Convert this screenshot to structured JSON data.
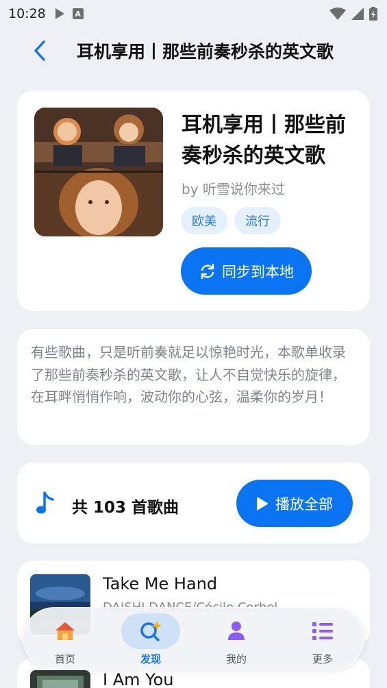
{
  "status_bar": {
    "time": "10:28"
  },
  "header": {
    "title": "耳机享用丨那些前奏秒杀的英文歌"
  },
  "playlist": {
    "name": "耳机享用丨那些前奏秒杀的英文歌",
    "author": "by 听雪说你来过",
    "tags": [
      "欧美",
      "流行"
    ],
    "sync_label": "同步到本地",
    "description": "有些歌曲，只是听前奏就足以惊艳时光，本歌单收录了那些前奏秒杀的英文歌，让人不自觉快乐的旋律，在耳畔悄悄作响，波动你的心弦，温柔你的岁月！"
  },
  "summary": {
    "count_label": "共 103 首歌曲",
    "play_all_label": "播放全部"
  },
  "songs": [
    {
      "title": "Take Me Hand",
      "artist": "DAISHI DANCE/Cécile Corbel"
    },
    {
      "title": "I Am You"
    }
  ],
  "bottom_nav": {
    "items": [
      {
        "label": "首页",
        "icon": "home-icon"
      },
      {
        "label": "发现",
        "icon": "discover-icon",
        "active": true
      },
      {
        "label": "我的",
        "icon": "person-icon"
      },
      {
        "label": "更多",
        "icon": "more-list-icon"
      }
    ]
  },
  "colors": {
    "accent": "#0b74f2",
    "background": "#eef0f6",
    "tag_bg": "#e5f0fd"
  }
}
